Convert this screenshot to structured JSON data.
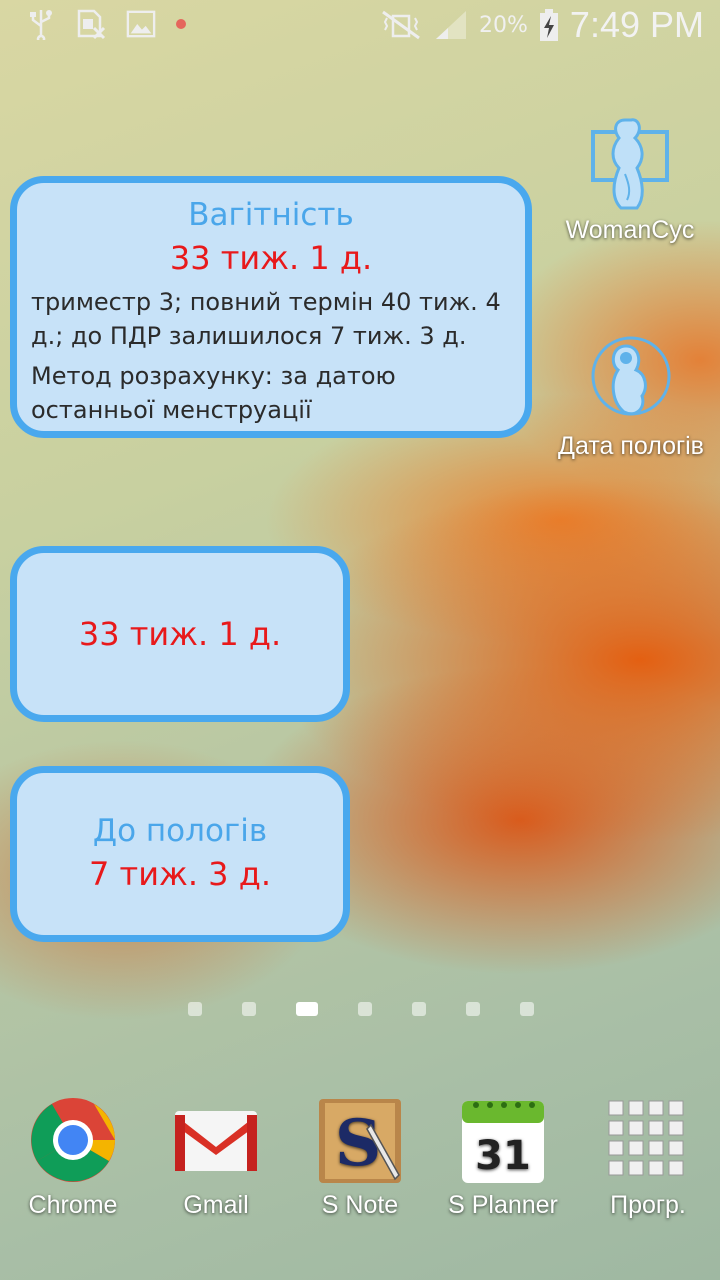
{
  "status_bar": {
    "battery": "20%",
    "time": "7:49 PM"
  },
  "widgets": {
    "pregnancy": {
      "title": "Вагітність",
      "weeks": "33 тиж. 1 д.",
      "details": "триместр 3; повний термін 40 тиж. 4 д.; до ПДР залишилося 7 тиж. 3 д.",
      "method": "Метод розрахунку: за датою останньої менструації"
    },
    "weeks_only": {
      "weeks": "33 тиж. 1 д."
    },
    "until_birth": {
      "title": "До пологів",
      "value": "7 тиж. 3 д."
    }
  },
  "desktop_icons": [
    {
      "label": "WomanCyc",
      "icon": "woman-silhouette-icon"
    },
    {
      "label": "Дата пологів",
      "icon": "fetus-icon"
    }
  ],
  "page_indicator": {
    "count": 7,
    "active": 3
  },
  "dock": [
    {
      "label": "Chrome",
      "icon": "chrome-icon"
    },
    {
      "label": "Gmail",
      "icon": "gmail-icon"
    },
    {
      "label": "S Note",
      "icon": "snote-icon"
    },
    {
      "label": "S Planner",
      "icon": "calendar-icon",
      "day": "31"
    },
    {
      "label": "Прогр.",
      "icon": "apps-grid-icon"
    }
  ]
}
